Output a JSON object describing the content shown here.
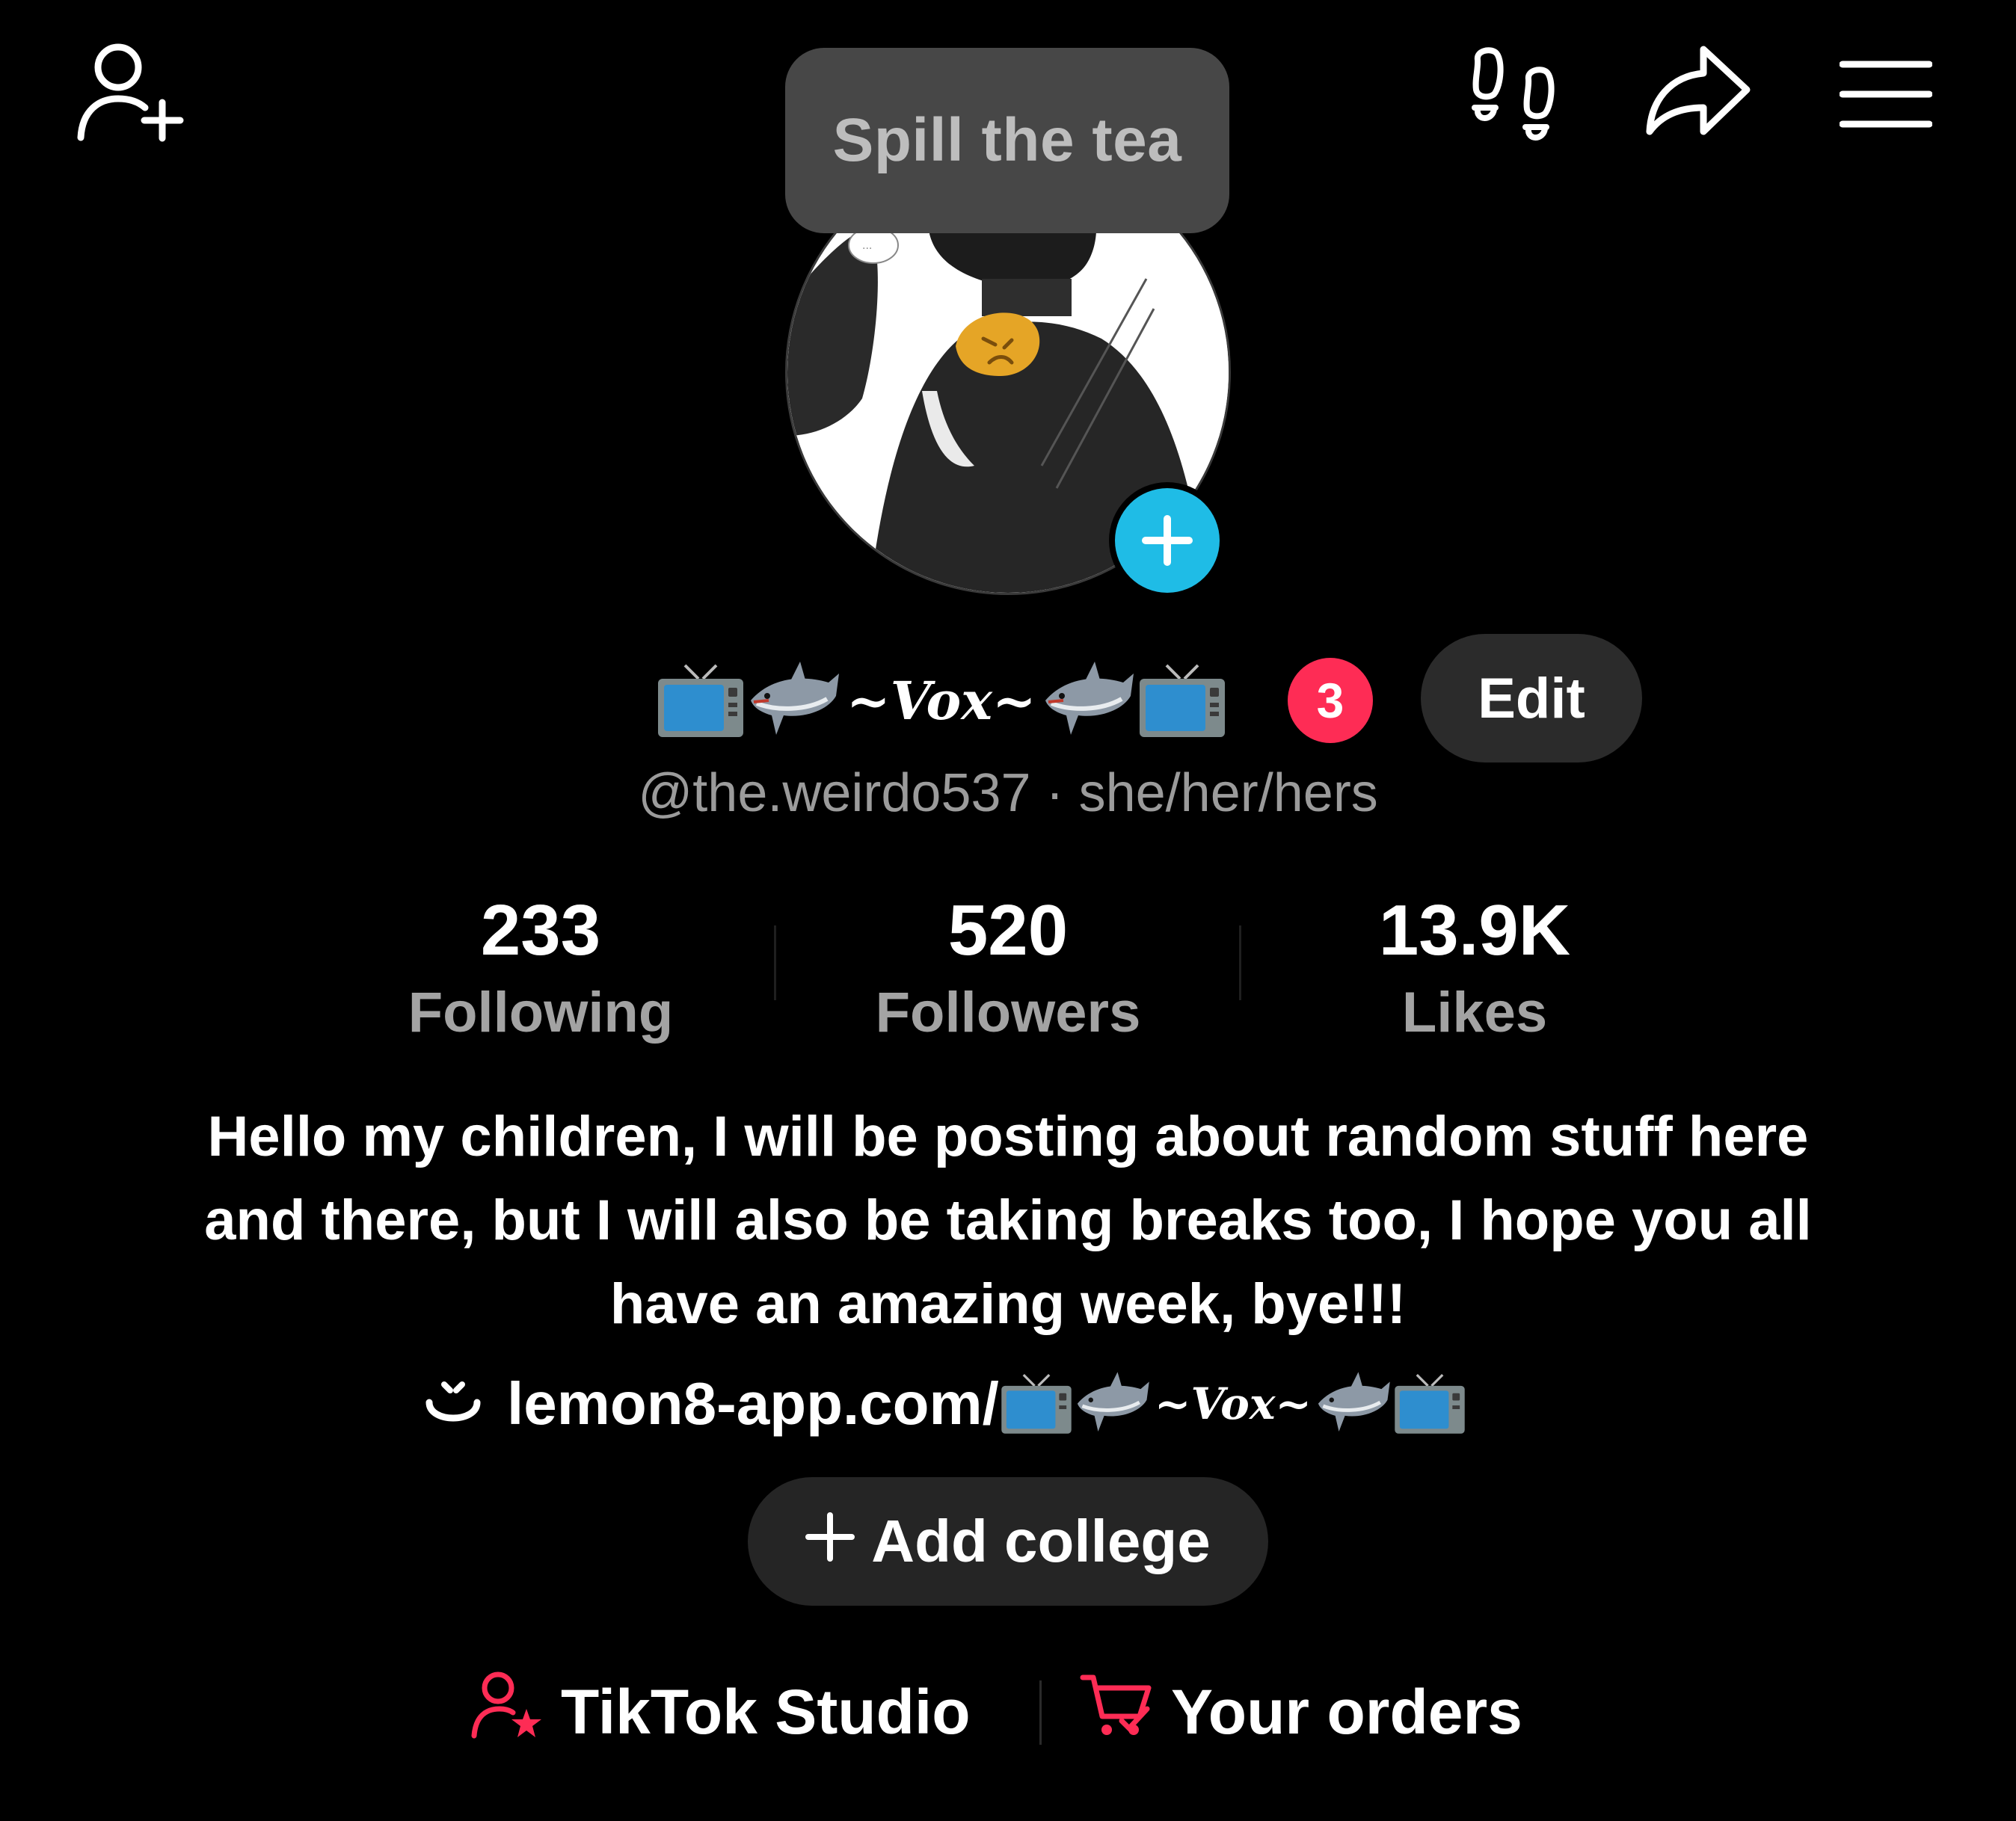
{
  "header": {
    "tooltip": "Spill the tea",
    "icons": [
      "add-friend-icon",
      "footprints-icon",
      "share-icon",
      "menu-icon"
    ]
  },
  "profile": {
    "display_name": "~Vox~",
    "name_emojis": [
      "tv",
      "shark",
      "shark",
      "tv"
    ],
    "notification_count": "3",
    "edit_label": "Edit",
    "handle": "@the.weirdo537 · she/her/hers"
  },
  "stats": [
    {
      "value": "233",
      "label": "Following"
    },
    {
      "value": "520",
      "label": "Followers"
    },
    {
      "value": "13.9K",
      "label": "Likes"
    }
  ],
  "bio": {
    "text": "Hello my children, I will be posting about random stuff here and there, but I will also be taking breaks too, I hope you all have an amazing week, bye!!!",
    "link_prefix": "lemon8-app.com/",
    "link_name": "~Vox~"
  },
  "college": {
    "label": "Add college"
  },
  "tools": {
    "studio_label": "TikTok Studio",
    "orders_label": "Your orders"
  },
  "colors": {
    "background": "#000000",
    "accent_red": "#fe2c55",
    "accent_blue": "#1fbce6",
    "muted_text": "#a3a3a3"
  }
}
